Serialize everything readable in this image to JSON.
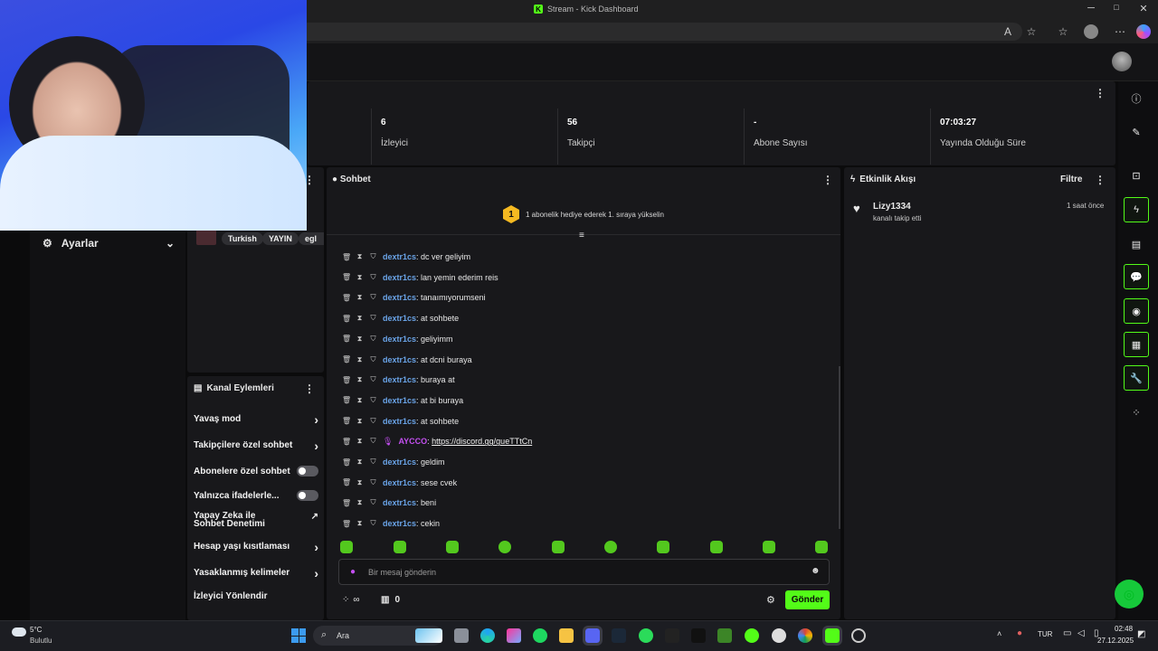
{
  "window": {
    "title": "Stream - Kick Dashboard",
    "favicon_letter": "K"
  },
  "browser": {
    "read_aloud": "A",
    "min": "─",
    "max": "□",
    "close": "✕"
  },
  "stats": [
    {
      "value": "6",
      "label": "İzleyici"
    },
    {
      "value": "56",
      "label": "Takipçi"
    },
    {
      "value": "-",
      "label": "Abone Sayısı"
    },
    {
      "value": "07:03:27",
      "label": "Yayında Olduğu Süre"
    }
  ],
  "left_nav": {
    "settings_label": "Ayarlar"
  },
  "tags": [
    "Turkish",
    "YAYIN",
    "egl"
  ],
  "channel_actions": {
    "title": "Kanal Eylemleri",
    "items": [
      {
        "label": "Yavaş mod",
        "control": "chevron"
      },
      {
        "label": "Takipçilere özel sohbet",
        "control": "chevron"
      },
      {
        "label": "Abonelere özel sohbet",
        "control": "toggle"
      },
      {
        "label": "Yalnızca ifadelerle...",
        "control": "toggle"
      },
      {
        "label": "Yapay Zeka ile Sohbet Denetimi",
        "control": "external"
      },
      {
        "label": "Hesap yaşı kısıtlaması",
        "control": "chevron"
      },
      {
        "label": "Yasaklanmış kelimeler",
        "control": "chevron"
      },
      {
        "label": "İzleyici Yönlendir",
        "control": "none"
      }
    ]
  },
  "chat": {
    "title": "Sohbet",
    "pinned": {
      "rank": "1",
      "text": "1 abonelik hediye ederek 1. sıraya yükselin"
    },
    "messages": [
      {
        "user": "dextr1cs",
        "text": "dc ver geliyim"
      },
      {
        "user": "dextr1cs",
        "text": "lan yemin ederim reis"
      },
      {
        "user": "dextr1cs",
        "text": "tanaımıyorumseni"
      },
      {
        "user": "dextr1cs",
        "text": "at sohbete"
      },
      {
        "user": "dextr1cs",
        "text": "geliyimm"
      },
      {
        "user": "dextr1cs",
        "text": "at dcni buraya"
      },
      {
        "user": "dextr1cs",
        "text": "buraya at"
      },
      {
        "user": "dextr1cs",
        "text": "at bi buraya"
      },
      {
        "user": "dextr1cs",
        "text": "at sohbete"
      },
      {
        "user": "AYCCO",
        "text": "https://discord.gg/gueTTtCn",
        "link": true
      },
      {
        "user": "dextr1cs",
        "text": "geldim"
      },
      {
        "user": "dextr1cs",
        "text": "sese cvek"
      },
      {
        "user": "dextr1cs",
        "text": "beni"
      },
      {
        "user": "dextr1cs",
        "text": "cekin"
      }
    ],
    "input_placeholder": "Bir mesaj gönderin",
    "points_count": "0",
    "infinity": "∞",
    "send_label": "Gönder"
  },
  "activity": {
    "title": "Etkinlik Akışı",
    "filter_label": "Filtre",
    "events": [
      {
        "user": "Lizy1334",
        "action": "kanalı takip etti",
        "time": "1 saat önce"
      }
    ]
  },
  "taskbar": {
    "weather_temp": "5°C",
    "weather_desc": "Bulutlu",
    "search_label": "Ara",
    "lang": "TUR",
    "time": "02:48",
    "date": "27.12.2025"
  },
  "colors": {
    "accent": "#53fc18",
    "panel": "#18181b",
    "username": "#6aa4e8",
    "mod_username": "#c34ff0"
  }
}
